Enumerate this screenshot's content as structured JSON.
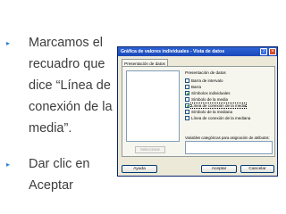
{
  "slide": {
    "bullets": [
      {
        "lines": [
          "Marcamos el",
          "recuadro que",
          "dice “Línea de",
          "conexión de la",
          "media”."
        ]
      },
      {
        "lines": [
          "Dar clic en",
          "Aceptar"
        ]
      }
    ],
    "bullet_glyph": "▸"
  },
  "dialog": {
    "title": "Gráfica de valores individuales - Vista de datos",
    "tab_label": "Presentación de datos",
    "group_label": "Presentación de datos",
    "options": [
      {
        "label": "Barra de intervalo",
        "checked": false
      },
      {
        "label": "Barra",
        "checked": false
      },
      {
        "label": "Símbolos individuales",
        "checked": true
      },
      {
        "label": "Símbolo de la media",
        "checked": false
      },
      {
        "label": "Línea de conexión de la media",
        "checked": true
      },
      {
        "label": "Símbolo de la mediana",
        "checked": false
      },
      {
        "label": "Línea de conexión de la mediana",
        "checked": false
      }
    ],
    "select_button": "Seleccionar",
    "variables_label": "Variables categóricas para asignación de atributos:",
    "buttons": {
      "help": "Ayuda",
      "ok": "Aceptar",
      "cancel": "Cancelar"
    }
  },
  "colors": {
    "title_bar": "#1a49b8",
    "dialog_bg": "#ece9d8",
    "bullet": "#2a7fd4"
  }
}
